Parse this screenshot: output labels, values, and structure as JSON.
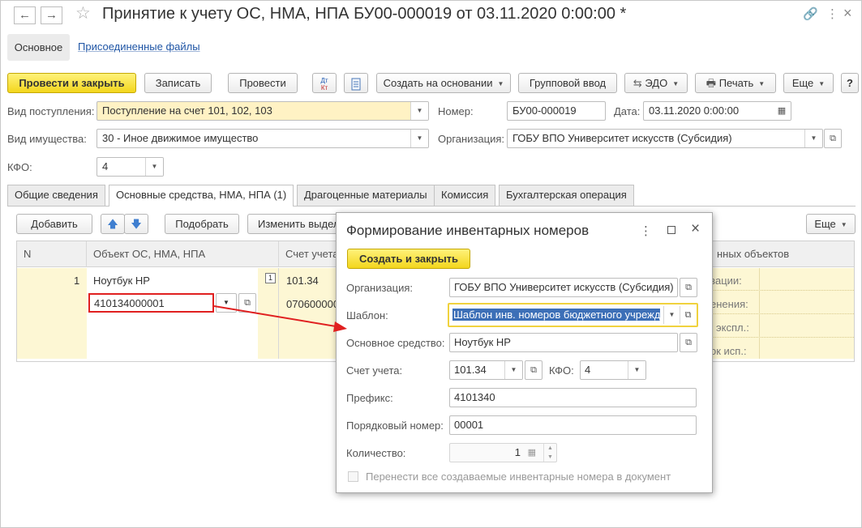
{
  "window": {
    "title": "Принятие к учету ОС, НМА, НПА БУ00-000019 от 03.11.2020 0:00:00 *"
  },
  "sections": {
    "main": "Основное",
    "attached": "Присоединенные файлы"
  },
  "toolbar": {
    "post_close": "Провести и закрыть",
    "save": "Записать",
    "post": "Провести",
    "dtkt_top": "Дт",
    "dtkt_bottom": "Кт",
    "create_based": "Создать на основании",
    "group_input": "Групповой ввод",
    "edo": "ЭДО",
    "print": "Печать",
    "more": "Еще",
    "help": "?"
  },
  "header": {
    "receipt_type_label": "Вид поступления:",
    "receipt_type_value": "Поступление на счет 101, 102, 103",
    "number_label": "Номер:",
    "number_value": "БУ00-000019",
    "date_label": "Дата:",
    "date_value": "03.11.2020  0:00:00",
    "property_type_label": "Вид имущества:",
    "property_type_value": "30 - Иное движимое имущество",
    "org_label": "Организация:",
    "org_value": "ГОБУ ВПО Университет искусств (Субсидия)",
    "kfo_label": "КФО:",
    "kfo_value": "4"
  },
  "tabs": [
    {
      "label": "Общие сведения"
    },
    {
      "label": "Основные средства, НМА, НПА (1)"
    },
    {
      "label": "Драгоценные материалы"
    },
    {
      "label": "Комиссия"
    },
    {
      "label": "Бухгалтерская операция"
    }
  ],
  "table_toolbar": {
    "add": "Добавить",
    "select": "Подобрать",
    "change": "Изменить выдел",
    "more": "Еще"
  },
  "table": {
    "columns": [
      "N",
      "Объект ОС, НМА, НПА",
      "Счет учета",
      "нных объектов"
    ],
    "row": {
      "n": "1",
      "object": "Ноутбук HP",
      "inv_number": "410134000001",
      "account": "101.34",
      "account2": "070600000",
      "col_badge": "1",
      "right_labels": [
        "зации:",
        "енения:",
        "экспл.:",
        "ок исп.:"
      ]
    }
  },
  "modal": {
    "title": "Формирование инвентарных номеров",
    "create_close": "Создать и закрыть",
    "org_label": "Организация:",
    "org_value": "ГОБУ ВПО Университет искусств (Субсидия)",
    "template_label": "Шаблон:",
    "template_value": "Шаблон инв. номеров бюджетного учрежд",
    "asset_label": "Основное средство:",
    "asset_value": "Ноутбук HP",
    "account_label": "Счет учета:",
    "account_value": "101.34",
    "kfo_label": "КФО:",
    "kfo_value": "4",
    "prefix_label": "Префикс:",
    "prefix_value": "4101340",
    "seq_label": "Порядковый номер:",
    "seq_value": "00001",
    "qty_label": "Количество:",
    "qty_value": "1",
    "transfer_label": "Перенести все создаваемые инвентарные номера в документ"
  },
  "colors": {
    "accent_yellow": "#f3d61d",
    "row_yellow": "#fdf7d4",
    "link_blue": "#1f55a5",
    "annotation_red": "#e02020"
  }
}
